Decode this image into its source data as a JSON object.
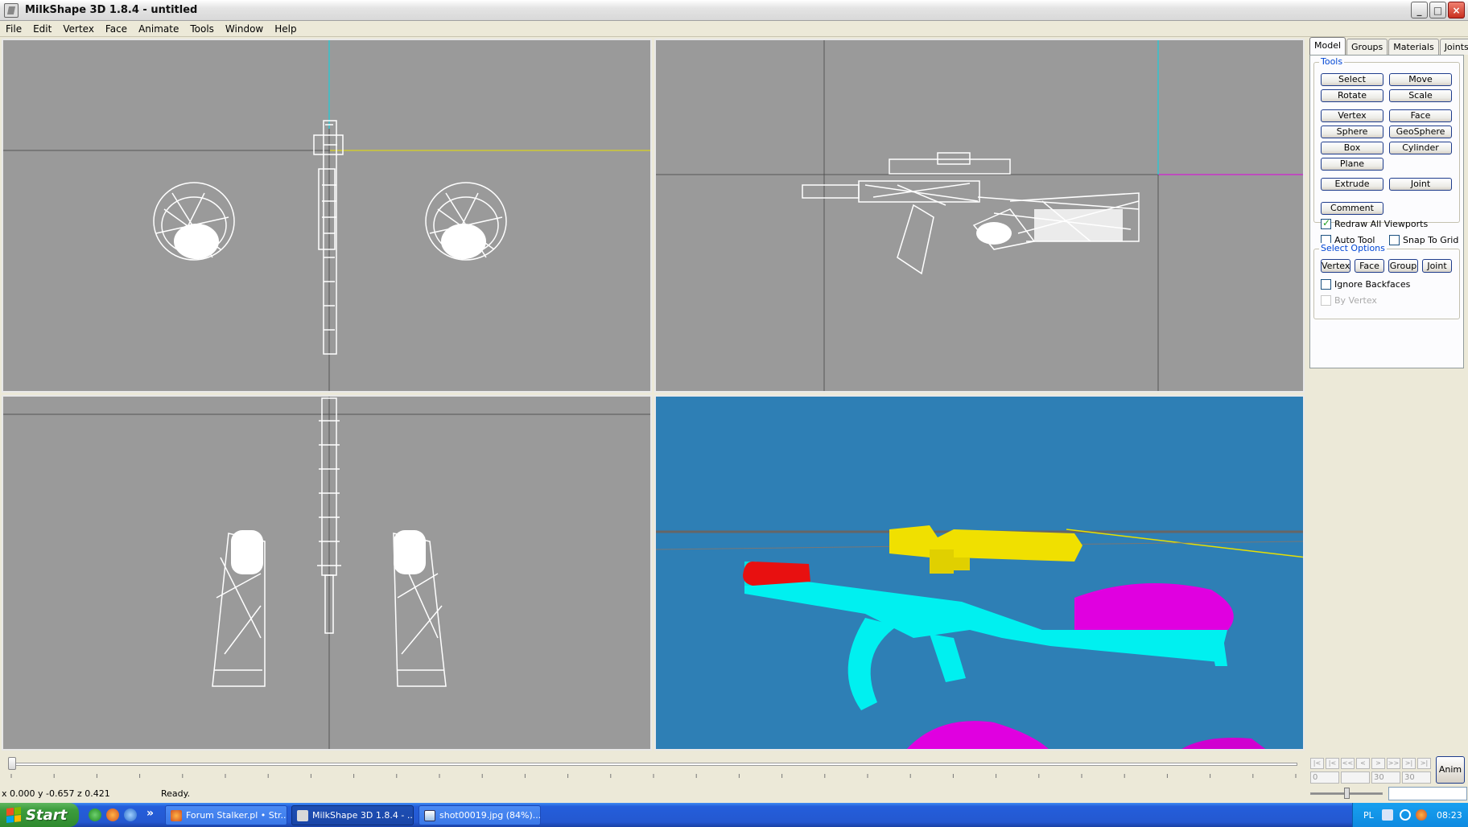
{
  "window": {
    "title": "MilkShape 3D 1.8.4 - untitled",
    "controls": [
      "_",
      "□",
      "×"
    ]
  },
  "menu": [
    "File",
    "Edit",
    "Vertex",
    "Face",
    "Animate",
    "Tools",
    "Window",
    "Help"
  ],
  "panel": {
    "tabs": [
      "Model",
      "Groups",
      "Materials",
      "Joints"
    ],
    "tools_title": "Tools",
    "tools": {
      "select": "Select",
      "move": "Move",
      "rotate": "Rotate",
      "scale": "Scale",
      "vertex": "Vertex",
      "face": "Face",
      "sphere": "Sphere",
      "geosphere": "GeoSphere",
      "box": "Box",
      "cylinder": "Cylinder",
      "plane": "Plane",
      "extrude": "Extrude",
      "joint": "Joint",
      "comment": "Comment"
    },
    "checks": {
      "redraw": "Redraw All Viewports",
      "auto_tool": "Auto Tool",
      "snap": "Snap To Grid",
      "ignore_backfaces": "Ignore Backfaces",
      "by_vertex": "By Vertex"
    },
    "check_states": {
      "redraw": true,
      "auto_tool": false,
      "snap": false,
      "ignore_backfaces": false,
      "by_vertex": false
    },
    "select_options_title": "Select Options",
    "select_options": [
      "Vertex",
      "Face",
      "Group",
      "Joint"
    ]
  },
  "timeline": {
    "nav_buttons": [
      "|<",
      "|<",
      "<<",
      "<",
      ">",
      ">>",
      ">|",
      ">|"
    ],
    "frames": [
      "0",
      "",
      "30",
      "30"
    ],
    "anim_button": "Anim"
  },
  "status": {
    "coords": "x 0.000 y -0.657 z 0.421",
    "message": "Ready."
  },
  "taskbar": {
    "start": "Start",
    "more": "»",
    "tasks": [
      "Forum Stalker.pl • Str...",
      "MilkShape 3D 1.8.4 - ...",
      "shot00019.jpg (84%)..."
    ],
    "lang": "PL",
    "clock": "08:23"
  },
  "colors": {
    "viewport_bg": "#9A9A9A",
    "viewport_3d_bg": "#2E7FB5",
    "wire": "#FFFFFF",
    "gun_body": "#00F0F0",
    "scope": "#F0E000",
    "silencer": "#E81010",
    "hands": "#E000E0"
  }
}
